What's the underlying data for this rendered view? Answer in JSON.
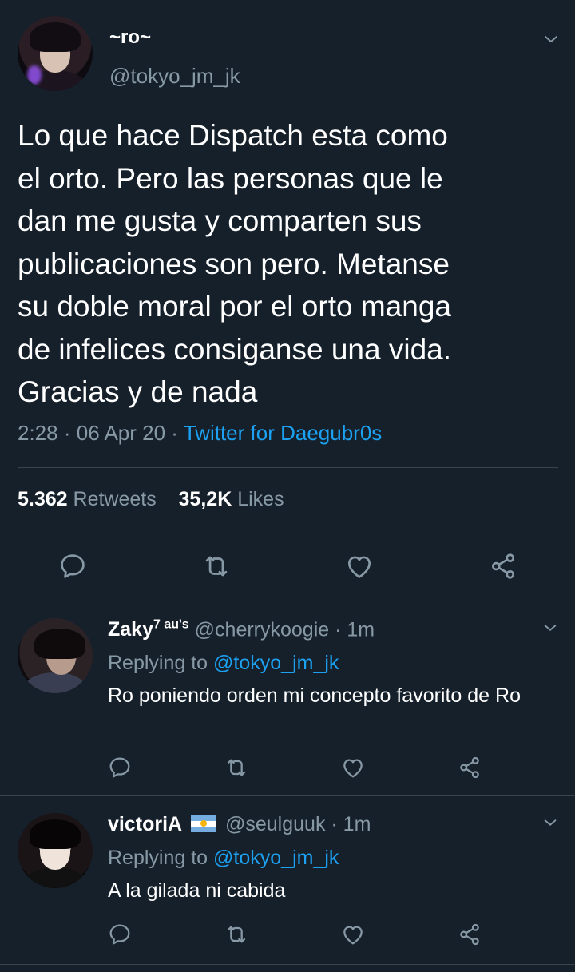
{
  "main_tweet": {
    "display_name": "~ro~",
    "handle": "@tokyo_jm_jk",
    "text": "Lo que hace Dispatch esta como\nel orto. Pero las personas que le\ndan me gusta y comparten sus\npublicaciones son pero. Metanse\nsu doble moral por el orto manga\nde infelices consiganse una vida.\nGracias y de nada",
    "time": "2:28",
    "date": "06 Apr 20",
    "separator": "·",
    "source": "Twitter for Daegubr0s",
    "retweets_count": "5.362",
    "retweets_label": "Retweets",
    "likes_count": "35,2K",
    "likes_label": "Likes",
    "actions": [
      "reply-icon",
      "retweet-icon",
      "like-icon",
      "share-icon"
    ]
  },
  "replies": [
    {
      "display_name": "Zaky",
      "name_suffix": "7 au's",
      "handle": "@cherrykoogie",
      "age": "· 1m",
      "replying_label": "Replying to",
      "replying_to": "@tokyo_jm_jk",
      "text": "Ro poniendo orden mi concepto favorito de Ro"
    },
    {
      "display_name": "victoriA",
      "flag_icon": "argentina-flag-icon",
      "handle": "@seulguuk",
      "age": "· 1m",
      "replying_label": "Replying to",
      "replying_to": "@tokyo_jm_jk",
      "text": "A la gilada ni cabida"
    }
  ],
  "colors": {
    "background": "#15202b",
    "text": "#ffffff",
    "muted": "#8899a6",
    "accent": "#1da1f2",
    "divider": "#38444d"
  }
}
